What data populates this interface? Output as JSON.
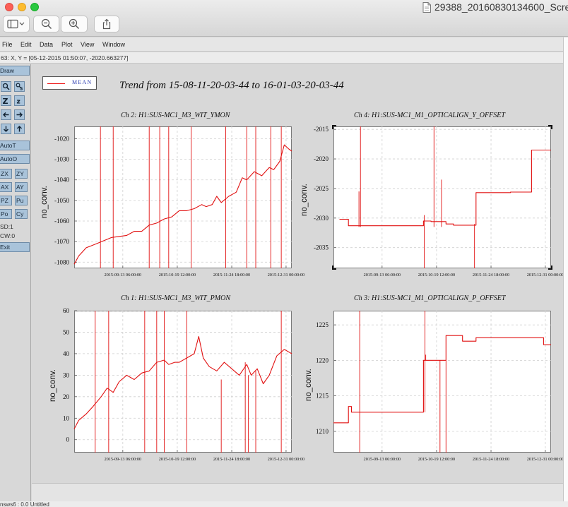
{
  "window": {
    "title": "29388_20160830134600_Scre",
    "toolbar": [
      "sidebar-toggle-icon",
      "zoom-out-icon",
      "zoom-in-icon",
      "share-icon"
    ]
  },
  "menu": [
    "File",
    "Edit",
    "Data",
    "Plot",
    "View",
    "Window"
  ],
  "coord_readout": "63: X, Y = [05-12-2015 01:50:07, -2020.663277]",
  "sidebar": {
    "draw_label": "Draw",
    "autot_label": "AutoT",
    "autoo_label": "AutoO",
    "pair_buttons": [
      [
        "ZX",
        "ZY"
      ],
      [
        "AX",
        "AY"
      ],
      [
        "PZ",
        "Pu"
      ],
      [
        "Po",
        "Cy"
      ]
    ],
    "sd_label": "SD:1",
    "cw_label": "CW:0",
    "exit_label": "Exit",
    "icons": [
      "magnify-icon",
      "magnify-text-icon",
      "zoom-z-icon",
      "zoom-z-small-icon",
      "arrow-left-icon",
      "arrow-right-icon",
      "arrow-down-icon",
      "arrow-up-icon"
    ]
  },
  "legend": {
    "label": "MEAN",
    "color": "#e11111"
  },
  "trend_title": "Trend from 15-08-11-20-03-44 to 16-01-03-20-03-44",
  "status_text": "nsws6 : 0.0   Untitled",
  "chart_data": [
    {
      "type": "line",
      "title": "Ch 2: H1:SUS-MC1_M3_WIT_YMON",
      "ylabel": "no_conv.",
      "xlabel": "",
      "x_ticks": [
        "2015-09-13 06:00:00",
        "2015-10-19 12:00:00",
        "2015-11-24 18:00:00",
        "2015-12-31 00:00:00"
      ],
      "x_tick_days": [
        32.4,
        68.7,
        105.0,
        141.2
      ],
      "y_ticks": [
        -1080,
        -1070,
        -1060,
        -1050,
        -1040,
        -1030,
        -1020
      ],
      "xlim_days": [
        0,
        145
      ],
      "ylim": [
        -1083,
        -1014
      ],
      "grid": true,
      "series": [
        {
          "name": "MEAN",
          "color": "#e11111",
          "x_days": [
            0,
            3,
            8,
            15,
            25,
            35,
            40,
            45,
            50,
            55,
            60,
            65,
            70,
            75,
            80,
            85,
            88,
            92,
            95,
            98,
            103,
            108,
            112,
            115,
            120,
            125,
            130,
            133,
            137,
            140,
            143,
            145
          ],
          "y": [
            -1081,
            -1077,
            -1073,
            -1071,
            -1068,
            -1067,
            -1065,
            -1065,
            -1062,
            -1061,
            -1059,
            -1058,
            -1055,
            -1055,
            -1054,
            -1052,
            -1053,
            -1052,
            -1048,
            -1051,
            -1048,
            -1046,
            -1039,
            -1040,
            -1036,
            -1038,
            -1034,
            -1035,
            -1031,
            -1023,
            -1025,
            -1026
          ],
          "spikes": [
            {
              "x": 17.5,
              "from": -1083,
              "to": -1014
            },
            {
              "x": 26,
              "from": -1083,
              "to": -1014
            },
            {
              "x": 50,
              "from": -1083,
              "to": -1014
            },
            {
              "x": 57,
              "from": -1083,
              "to": -1014
            },
            {
              "x": 63,
              "from": -1083,
              "to": -1014
            },
            {
              "x": 78,
              "from": -1083,
              "to": -1014
            },
            {
              "x": 101,
              "from": -1083,
              "to": -1014
            },
            {
              "x": 115,
              "from": -1083,
              "to": -1014
            },
            {
              "x": 121,
              "from": -1083,
              "to": -1014
            },
            {
              "x": 131,
              "from": -1083,
              "to": -1014
            },
            {
              "x": 138,
              "from": -1083,
              "to": -1014
            }
          ]
        }
      ]
    },
    {
      "type": "line",
      "title": "Ch 4: H1:SUS-MC1_M1_OPTICALIGN_Y_OFFSET",
      "ylabel": "no_conv.",
      "xlabel": "",
      "x_ticks": [
        "2015-09-13 06:00:00",
        "2015-10-19 12:00:00",
        "2015-11-24 18:00:00",
        "2015-12-31 00:00:00"
      ],
      "x_tick_days": [
        32.4,
        68.7,
        105.0,
        141.2
      ],
      "y_ticks": [
        -2035,
        -2030,
        -2025,
        -2020,
        -2015
      ],
      "xlim_days": [
        0,
        145
      ],
      "ylim": [
        -2038.5,
        -2014.5
      ],
      "grid": true,
      "series": [
        {
          "name": "MEAN",
          "color": "#e11111",
          "x_days": [
            4,
            10,
            10,
            20,
            30,
            40,
            50,
            60,
            60,
            65,
            65,
            75,
            75,
            80,
            80,
            95,
            95,
            100,
            100,
            118,
            118,
            132,
            132,
            145
          ],
          "y": [
            -2030.2,
            -2030.2,
            -2031.3,
            -2031.3,
            -2031.3,
            -2031.3,
            -2031.3,
            -2031.3,
            -2030.5,
            -2030.5,
            -2030.6,
            -2030.6,
            -2031,
            -2031,
            -2031.2,
            -2031.2,
            -2025.7,
            -2025.7,
            -2025.7,
            -2025.7,
            -2025.6,
            -2025.6,
            -2018.5,
            -2018.5
          ],
          "spikes": [
            {
              "x": 18,
              "from": -2031.5,
              "to": -2014.5
            },
            {
              "x": 17,
              "from": -2031.5,
              "to": -2025.5
            },
            {
              "x": 60.5,
              "from": -2038.5,
              "to": -2029.5
            },
            {
              "x": 67,
              "from": -2031.5,
              "to": -2014.5
            },
            {
              "x": 72,
              "from": -2031.5,
              "to": -2023.5
            },
            {
              "x": 94,
              "from": -2038.5,
              "to": -2031
            }
          ]
        }
      ]
    },
    {
      "type": "line",
      "title": "Ch 1: H1:SUS-MC1_M3_WIT_PMON",
      "ylabel": "no_conv.",
      "xlabel": "",
      "x_ticks": [
        "2015-09-13 06:00:00",
        "2015-10-19 12:00:00",
        "2015-11-24 18:00:00",
        "2015-12-31 00:00:00"
      ],
      "x_tick_days": [
        32.4,
        68.7,
        105.0,
        141.2
      ],
      "y_ticks": [
        0,
        10,
        20,
        30,
        40,
        50,
        60
      ],
      "xlim_days": [
        0,
        145
      ],
      "ylim": [
        -6,
        60
      ],
      "grid": true,
      "series": [
        {
          "name": "MEAN",
          "color": "#e11111",
          "x_days": [
            0,
            3,
            8,
            12,
            18,
            22,
            26,
            30,
            35,
            40,
            45,
            50,
            55,
            60,
            63,
            67,
            70,
            75,
            80,
            83,
            86,
            90,
            95,
            100,
            105,
            110,
            115,
            118,
            122,
            126,
            130,
            135,
            140,
            145
          ],
          "y": [
            5,
            9,
            12,
            15,
            20,
            24,
            22,
            27,
            30,
            28,
            31,
            32,
            36,
            37,
            35,
            36,
            36,
            38,
            40,
            48,
            38,
            34,
            32,
            36,
            33,
            30,
            35,
            30,
            33,
            26,
            30,
            39,
            42,
            40
          ],
          "spikes": [
            {
              "x": 14,
              "from": -6,
              "to": 60
            },
            {
              "x": 23,
              "from": -6,
              "to": 60
            },
            {
              "x": 47,
              "from": -6,
              "to": 60
            },
            {
              "x": 55,
              "from": -6,
              "to": 60
            },
            {
              "x": 60,
              "from": -6,
              "to": 60
            },
            {
              "x": 75,
              "from": -6,
              "to": 60
            },
            {
              "x": 98,
              "from": -6,
              "to": 28
            },
            {
              "x": 114,
              "from": -6,
              "to": 36
            },
            {
              "x": 116,
              "from": -6,
              "to": 30
            },
            {
              "x": 121,
              "from": -6,
              "to": 32
            },
            {
              "x": 138,
              "from": -6,
              "to": 60
            }
          ]
        }
      ]
    },
    {
      "type": "line",
      "title": "Ch 3: H1:SUS-MC1_M1_OPTICALIGN_P_OFFSET",
      "ylabel": "no_conv.",
      "xlabel": "",
      "x_ticks": [
        "2015-09-13 06:00:00",
        "2015-10-19 12:00:00",
        "2015-11-24 18:00:00",
        "2015-12-31 00:00:00"
      ],
      "x_tick_days": [
        32.4,
        68.7,
        105.0,
        141.2
      ],
      "y_ticks": [
        1210,
        1215,
        1220,
        1225
      ],
      "xlim_days": [
        0,
        145
      ],
      "ylim": [
        1207,
        1227
      ],
      "grid": true,
      "series": [
        {
          "name": "MEAN",
          "color": "#e11111",
          "x_days": [
            0,
            10,
            10,
            12,
            12,
            20,
            30,
            40,
            50,
            60,
            60,
            62,
            62,
            67,
            67,
            75,
            75,
            86,
            86,
            95,
            95,
            98,
            98,
            112,
            112,
            125,
            125,
            140,
            140,
            145
          ],
          "y": [
            1211.2,
            1211.2,
            1213.5,
            1213.5,
            1212.7,
            1212.7,
            1212.7,
            1212.7,
            1212.7,
            1212.7,
            1220,
            1220,
            1220,
            1220,
            1220,
            1220,
            1223.5,
            1223.5,
            1222.7,
            1222.7,
            1223.2,
            1223.2,
            1223.2,
            1223.2,
            1223.2,
            1223.2,
            1223.2,
            1223.2,
            1222.2,
            1222.2
          ],
          "spikes": [
            {
              "x": 17.5,
              "from": 1207,
              "to": 1227
            },
            {
              "x": 61,
              "from": 1212.7,
              "to": 1227
            },
            {
              "x": 61.5,
              "from": 1220,
              "to": 1220.8
            },
            {
              "x": 71,
              "from": 1207,
              "to": 1220
            },
            {
              "x": 75,
              "from": 1207,
              "to": 1220
            }
          ]
        }
      ]
    }
  ]
}
